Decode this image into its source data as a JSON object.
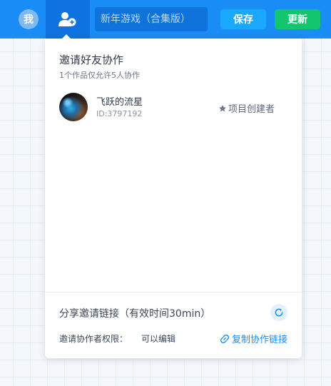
{
  "header": {
    "user_avatar_text": "我",
    "invite_icon": "add-user-icon",
    "title_placeholder": "新年游戏（合集版）",
    "save_label": "保存",
    "update_label": "更新"
  },
  "invite_panel": {
    "title": "邀请好友协作",
    "subtitle": "1个作品仅允许5人协作",
    "members": [
      {
        "name": "飞跃的流星",
        "id": "ID:3797192",
        "role": "项目创建者",
        "role_icon": "star-icon"
      }
    ],
    "share": {
      "title": "分享邀请链接（有效时间30min）",
      "refresh_icon": "refresh-icon",
      "permission_label": "邀请协作者权限：",
      "permission_value": "可以编辑",
      "copy_label": "复制协作链接",
      "copy_icon": "link-icon"
    }
  },
  "colors": {
    "topbar": "#1a8cf5",
    "save": "#18a9ff",
    "update": "#12c56f",
    "link": "#1a8cf5"
  }
}
